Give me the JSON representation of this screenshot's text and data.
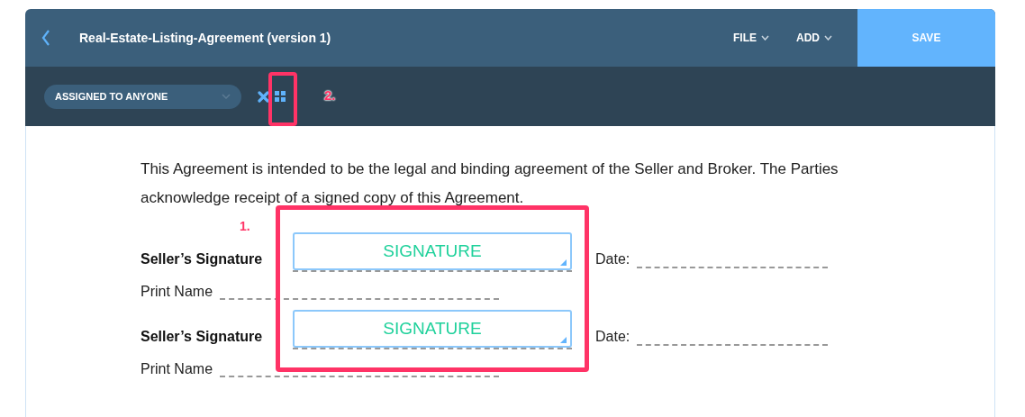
{
  "header": {
    "title": "Real-Estate-Listing-Agreement (version 1)",
    "menus": [
      {
        "label": "FILE"
      },
      {
        "label": "ADD"
      }
    ],
    "save_button": "SAVE"
  },
  "toolbar": {
    "assignee_filter": "ASSIGNED TO ANYONE"
  },
  "document": {
    "paragraph": "This Agreement is intended to be the legal and binding agreement of the Seller and Broker. The Parties acknowledge receipt of a signed copy of this Agreement.",
    "signature_blocks": [
      {
        "label": "Seller’s Signature",
        "field": "SIGNATURE",
        "date_label": "Date:",
        "print_name_label": "Print Name"
      },
      {
        "label": "Seller’s Signature",
        "field": "SIGNATURE",
        "date_label": "Date:",
        "print_name_label": "Print Name"
      }
    ]
  },
  "annotations": [
    {
      "label": "1."
    },
    {
      "label": "2."
    }
  ]
}
